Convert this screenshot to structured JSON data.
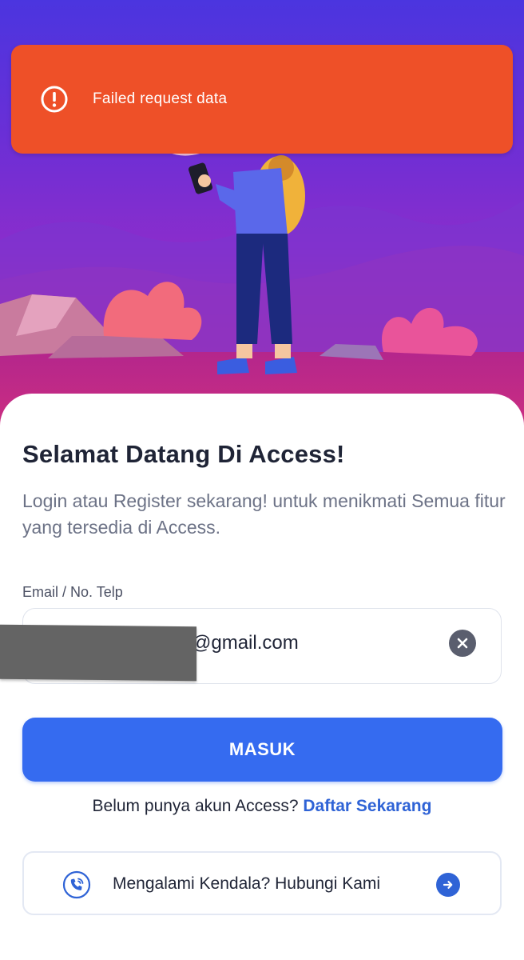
{
  "toast": {
    "message": "Failed request data",
    "icon": "alert-circle-icon",
    "color": "#ee5028"
  },
  "welcome": {
    "title": "Selamat Datang Di Access!",
    "subtitle": "Login atau Register sekarang! untuk menikmati Semua fitur yang tersedia di Access."
  },
  "login_form": {
    "email_label": "Email / No. Telp",
    "email_value": "@gmail.com",
    "clear_icon": "clear-icon",
    "submit_label": "MASUK"
  },
  "register": {
    "prompt": "Belum punya akun Access?",
    "link": "Daftar Sekarang"
  },
  "help": {
    "label": "Mengalami Kendala? Hubungi Kami",
    "icon": "phone-support-icon",
    "arrow_icon": "arrow-right-icon"
  },
  "colors": {
    "primary": "#356bf0",
    "link": "#2f63d6",
    "error": "#ee5028",
    "heading": "#1f2436"
  }
}
